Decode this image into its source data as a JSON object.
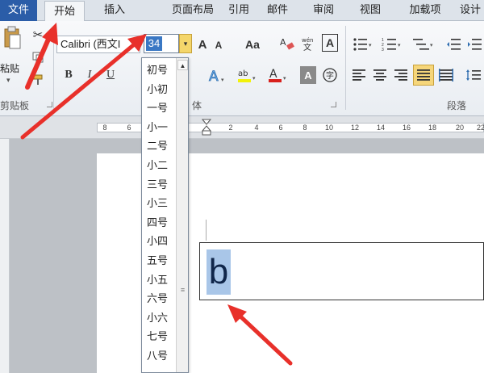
{
  "tabs": {
    "file": "文件",
    "home": "开始",
    "insert": "插入",
    "page_layout": "页面布局",
    "references": "引用",
    "mailings": "邮件",
    "review": "审阅",
    "view": "视图",
    "addins": "加载项",
    "design": "设计"
  },
  "ribbon": {
    "clipboard": {
      "paste_label": "粘贴",
      "group_label": "剪贴板"
    },
    "font": {
      "font_name": "Calibri (西文I",
      "font_size": "34",
      "grow_label": "A",
      "shrink_label": "A",
      "case_label": "Aa",
      "bold": "B",
      "italic": "I",
      "underline": "U",
      "group_label": "体"
    },
    "paragraph": {
      "group_label": "段落"
    }
  },
  "ruler": {
    "labels": [
      "8",
      "6",
      "2",
      "2",
      "4",
      "6",
      "8",
      "10",
      "12",
      "14",
      "16",
      "18",
      "20",
      "22"
    ]
  },
  "font_size_list": {
    "items": [
      "初号",
      "小初",
      "一号",
      "小一",
      "二号",
      "小二",
      "三号",
      "小三",
      "四号",
      "小四",
      "五号",
      "小五",
      "六号",
      "小六",
      "七号",
      "八号"
    ]
  },
  "document": {
    "selected_text": "b"
  },
  "colors": {
    "file_tab": "#2b5da8",
    "size_highlight": "#3a78c4",
    "arrow": "#e8302a",
    "selection": "#a9c6e8"
  }
}
